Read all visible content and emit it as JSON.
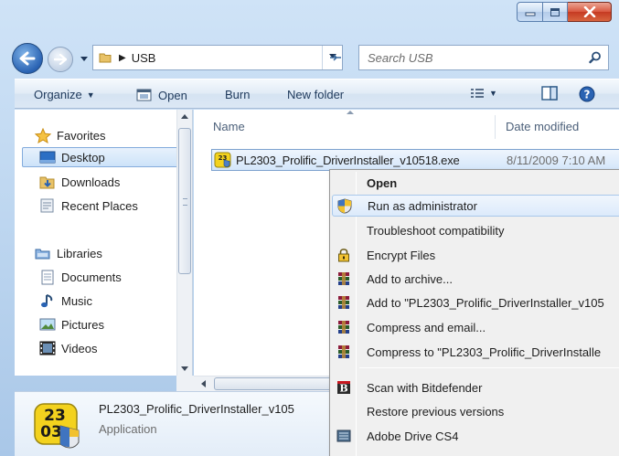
{
  "window": {
    "address_crumb": "USB",
    "search_placeholder": "Search USB"
  },
  "toolbar": {
    "organize": "Organize",
    "open": "Open",
    "burn": "Burn",
    "new_folder": "New folder"
  },
  "nav": {
    "favorites": "Favorites",
    "desktop": "Desktop",
    "downloads": "Downloads",
    "recent_places": "Recent Places",
    "libraries": "Libraries",
    "documents": "Documents",
    "music": "Music",
    "pictures": "Pictures",
    "videos": "Videos"
  },
  "columns": {
    "name": "Name",
    "date_modified": "Date modified"
  },
  "file": {
    "name": "PL2303_Prolific_DriverInstaller_v10518.exe",
    "date": "8/11/2009 7:10 AM"
  },
  "details": {
    "name": "PL2303_Prolific_DriverInstaller_v105",
    "type": "Application",
    "icon_text_top": "23",
    "icon_text_bottom": "03"
  },
  "context_menu": {
    "open": "Open",
    "run_as_admin": "Run as administrator",
    "troubleshoot": "Troubleshoot compatibility",
    "encrypt": "Encrypt Files",
    "add_archive": "Add to archive...",
    "add_to_named": "Add to \"PL2303_Prolific_DriverInstaller_v105",
    "compress_email": "Compress and email...",
    "compress_to_named": "Compress to \"PL2303_Prolific_DriverInstalle",
    "scan_bitdefender": "Scan with Bitdefender",
    "restore_versions": "Restore previous versions",
    "adobe_drive": "Adobe Drive CS4",
    "bitdefender_letter": "B"
  },
  "colors": {
    "accent": "#2a63b3",
    "selection": "#cde3f9",
    "close_button": "#c53a22"
  }
}
